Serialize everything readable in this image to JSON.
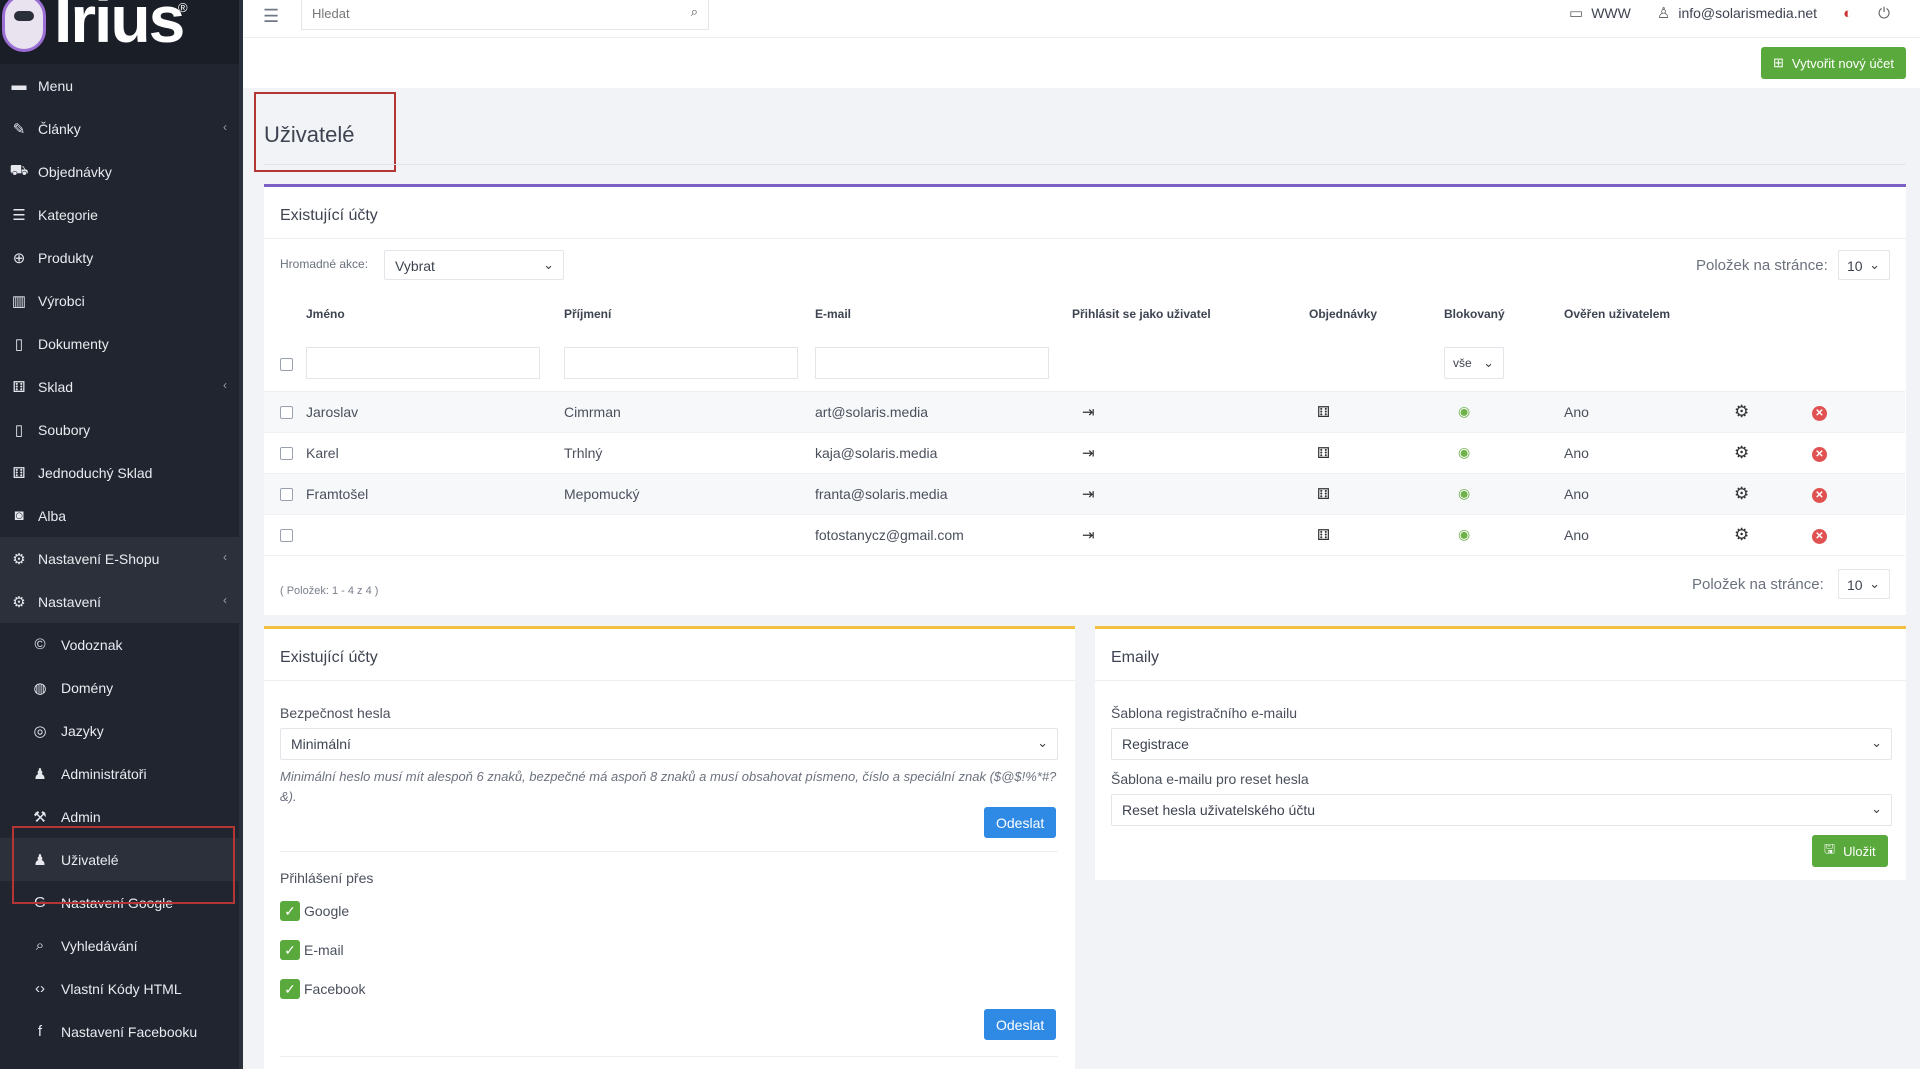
{
  "sidebar": {
    "logo_text": "Irius",
    "items": [
      {
        "label": "Menu",
        "icon": "folder-icon"
      },
      {
        "label": "Články",
        "icon": "pencil-icon",
        "chevron": "‹"
      },
      {
        "label": "Objednávky",
        "icon": "cart-icon"
      },
      {
        "label": "Kategorie",
        "icon": "list-icon"
      },
      {
        "label": "Produkty",
        "icon": "box-icon"
      },
      {
        "label": "Výrobci",
        "icon": "factory-icon"
      },
      {
        "label": "Dokumenty",
        "icon": "document-icon"
      },
      {
        "label": "Sklad",
        "icon": "warehouse-icon",
        "chevron": "‹"
      },
      {
        "label": "Soubory",
        "icon": "file-icon"
      },
      {
        "label": "Jednoduchý Sklad",
        "icon": "warehouse-icon"
      },
      {
        "label": "Alba",
        "icon": "camera-icon"
      },
      {
        "label": "Nastavení E-Shopu",
        "icon": "settings-icon",
        "chevron": "‹"
      },
      {
        "label": "Nastavení",
        "icon": "settings-icon",
        "chevron": "‹"
      },
      {
        "label": "Vodoznak",
        "icon": "copyright-icon"
      },
      {
        "label": "Domény",
        "icon": "globe-icon"
      },
      {
        "label": "Jazyky",
        "icon": "language-icon"
      },
      {
        "label": "Administrátoři",
        "icon": "admin-icon"
      },
      {
        "label": "Admin",
        "icon": "wrench-icon"
      },
      {
        "label": "Uživatelé",
        "icon": "user-icon"
      },
      {
        "label": "Nastavení Google",
        "icon": "google-icon"
      },
      {
        "label": "Vyhledávání",
        "icon": "search-icon"
      },
      {
        "label": "Vlastní Kódy HTML",
        "icon": "html-icon"
      },
      {
        "label": "Nastavení Facebooku",
        "icon": "facebook-icon"
      }
    ]
  },
  "topbar": {
    "search_placeholder": "Hledat",
    "www_label": "WWW",
    "user_email": "info@solarismedia.net"
  },
  "subheader": {
    "new_account_label": "Vytvořit nový účet"
  },
  "page": {
    "title": "Uživatelé"
  },
  "accounts_table": {
    "title": "Existující účty",
    "bulk_label": "Hromadné akce:",
    "bulk_value": "Vybrat",
    "per_page_label": "Položek na stránce:",
    "per_page_value": "10",
    "columns": [
      "Jméno",
      "Příjmení",
      "E-mail",
      "Přihlásit se jako uživatel",
      "Objednávky",
      "Blokovaný",
      "Ověřen uživatelem"
    ],
    "blocked_filter": "vše",
    "rows": [
      {
        "first": "Jaroslav",
        "last": "Cimrman",
        "email": "art@solaris.media",
        "verified": "Ano"
      },
      {
        "first": "Karel",
        "last": "Trhlný",
        "email": "kaja@solaris.media",
        "verified": "Ano"
      },
      {
        "first": "Framtošel",
        "last": "Mepomucký",
        "email": "franta@solaris.media",
        "verified": "Ano"
      },
      {
        "first": "",
        "last": "",
        "email": "fotostanycz@gmail.com",
        "verified": "Ano"
      }
    ],
    "count_text": "( Položek: 1 - 4 z 4 )"
  },
  "security_panel": {
    "title": "Existující účty",
    "password_label": "Bezpečnost hesla",
    "password_value": "Minimální",
    "hint": "Minimální heslo musí mít alespoň 6 znaků, bezpečné má aspoň 8 znaků a musí obsahovat písmeno, číslo a speciální znak ($@$!%*#?&).",
    "send_label": "Odeslat",
    "login_label": "Přihlášení přes",
    "login_options": [
      "Google",
      "E-mail",
      "Facebook"
    ],
    "send2_label": "Odeslat"
  },
  "emails_panel": {
    "title": "Emaily",
    "reg_label": "Šablona registračního e-mailu",
    "reg_value": "Registrace",
    "reset_label": "Šablona e-mailu pro reset hesla",
    "reset_value": "Reset hesla uživatelského účtu",
    "save_label": "Uložit"
  },
  "colors": {
    "accent_green": "#5aa93c",
    "accent_blue": "#2f8ae6",
    "purple": "#7b61c4",
    "yellow": "#f3c040",
    "danger": "#e05252",
    "highlight": "#b33535"
  }
}
